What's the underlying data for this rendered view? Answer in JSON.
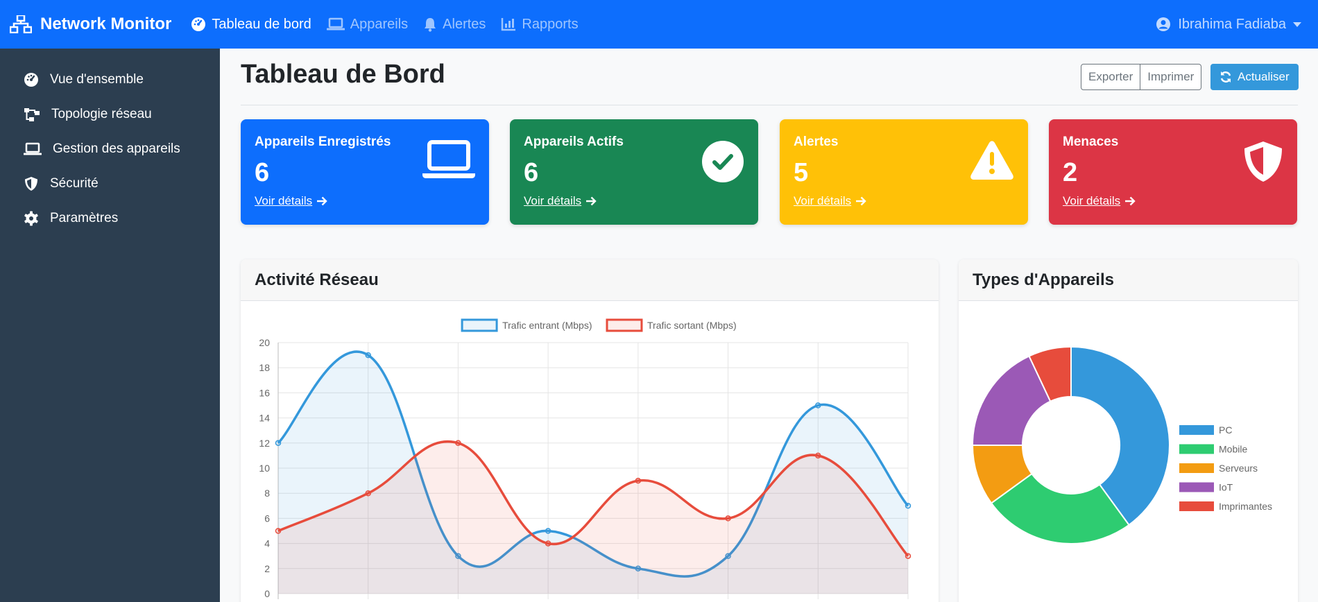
{
  "navbar": {
    "brand": "Network Monitor",
    "links": [
      {
        "label": "Tableau de bord",
        "icon": "dashboard-icon",
        "active": true
      },
      {
        "label": "Appareils",
        "icon": "laptop-icon",
        "active": false
      },
      {
        "label": "Alertes",
        "icon": "bell-icon",
        "active": false
      },
      {
        "label": "Rapports",
        "icon": "chart-icon",
        "active": false
      }
    ],
    "user": "Ibrahima Fadiaba"
  },
  "sidebar": {
    "items": [
      {
        "label": "Vue d'ensemble",
        "icon": "dashboard-icon"
      },
      {
        "label": "Topologie réseau",
        "icon": "topology-icon"
      },
      {
        "label": "Gestion des appareils",
        "icon": "laptop-icon"
      },
      {
        "label": "Sécurité",
        "icon": "shield-icon"
      },
      {
        "label": "Paramètres",
        "icon": "gear-icon"
      }
    ]
  },
  "header": {
    "title": "Tableau de Bord",
    "export_label": "Exporter",
    "print_label": "Imprimer",
    "refresh_label": "Actualiser"
  },
  "cards": [
    {
      "title": "Appareils Enregistrés",
      "value": "6",
      "link": "Voir détails",
      "color": "#0d6efd",
      "icon": "laptop-icon"
    },
    {
      "title": "Appareils Actifs",
      "value": "6",
      "link": "Voir détails",
      "color": "#198754",
      "icon": "check-circle-icon"
    },
    {
      "title": "Alertes",
      "value": "5",
      "link": "Voir détails",
      "color": "#ffc107",
      "icon": "warning-icon"
    },
    {
      "title": "Menaces",
      "value": "2",
      "link": "Voir détails",
      "color": "#dc3545",
      "icon": "shield-icon"
    }
  ],
  "panels": {
    "activity_title": "Activité Réseau",
    "types_title": "Types d'Appareils"
  },
  "chart_data": [
    {
      "type": "line",
      "title": "",
      "xlabel": "",
      "ylabel": "",
      "ylim": [
        0,
        20
      ],
      "yticks": [
        "0",
        "2",
        "4",
        "6",
        "8",
        "10",
        "12",
        "14",
        "16",
        "18",
        "20"
      ],
      "grid": true,
      "legend": "top",
      "series": [
        {
          "name": "Trafic entrant (Mbps)",
          "color": "#3498db",
          "values": [
            12,
            19,
            3,
            5,
            2,
            3,
            15,
            7
          ]
        },
        {
          "name": "Trafic sortant (Mbps)",
          "color": "#e74c3c",
          "values": [
            5,
            8,
            12,
            4,
            9,
            6,
            11,
            3
          ]
        }
      ]
    },
    {
      "type": "pie",
      "legend": "right",
      "slices": [
        {
          "label": "PC",
          "value": 40,
          "color": "#3498db"
        },
        {
          "label": "Mobile",
          "value": 25,
          "color": "#2ecc71"
        },
        {
          "label": "Serveurs",
          "value": 10,
          "color": "#f39c12"
        },
        {
          "label": "IoT",
          "value": 18,
          "color": "#9b59b6"
        },
        {
          "label": "Imprimantes",
          "value": 7,
          "color": "#e74c3c"
        }
      ]
    }
  ]
}
